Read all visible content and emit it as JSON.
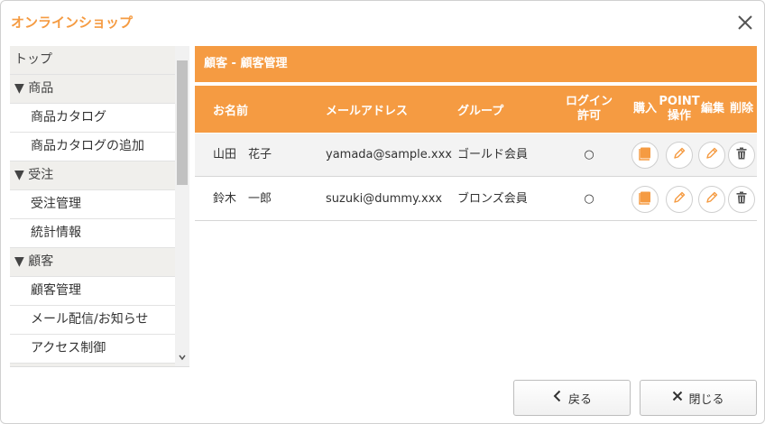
{
  "app": {
    "title": "オンラインショップ"
  },
  "sidebar": {
    "rows": [
      {
        "type": "cat",
        "label": "トップ"
      },
      {
        "type": "cat",
        "label": "▼ 商品"
      },
      {
        "type": "item",
        "label": "商品カタログ"
      },
      {
        "type": "item",
        "label": "商品カタログの追加"
      },
      {
        "type": "cat",
        "label": "▼ 受注"
      },
      {
        "type": "item",
        "label": "受注管理"
      },
      {
        "type": "item",
        "label": "統計情報"
      },
      {
        "type": "cat",
        "label": "▼ 顧客"
      },
      {
        "type": "item",
        "label": "顧客管理"
      },
      {
        "type": "item",
        "label": "メール配信/お知らせ"
      },
      {
        "type": "item",
        "label": "アクセス制御"
      }
    ]
  },
  "panel": {
    "title": "顧客 - 顧客管理"
  },
  "table": {
    "headers": {
      "name": "お名前",
      "email": "メールアドレス",
      "group": "グループ",
      "login_line1": "ログイン",
      "login_line2": "許可",
      "purchase": "購入",
      "point_line1": "POINT",
      "point_line2": "操作",
      "edit": "編集",
      "delete": "削除"
    },
    "rows": [
      {
        "name": "山田　花子",
        "email": "yamada@sample.xxx",
        "group": "ゴールド会員",
        "login": "○"
      },
      {
        "name": "鈴木　一郎",
        "email": "suzuki@dummy.xxx",
        "group": "ブロンズ会員",
        "login": "○"
      }
    ]
  },
  "footer": {
    "back_label": "戻る",
    "close_label": "閉じる"
  },
  "colors": {
    "accent": "#f59b42",
    "sidebar_category_bg": "#f0efec"
  },
  "icons": {
    "close": "close-icon",
    "purchase": "book-icon",
    "point": "pencil-icon",
    "edit": "pencil-icon",
    "delete": "trash-icon",
    "back": "chevron-left-icon",
    "close_button": "x-icon"
  }
}
